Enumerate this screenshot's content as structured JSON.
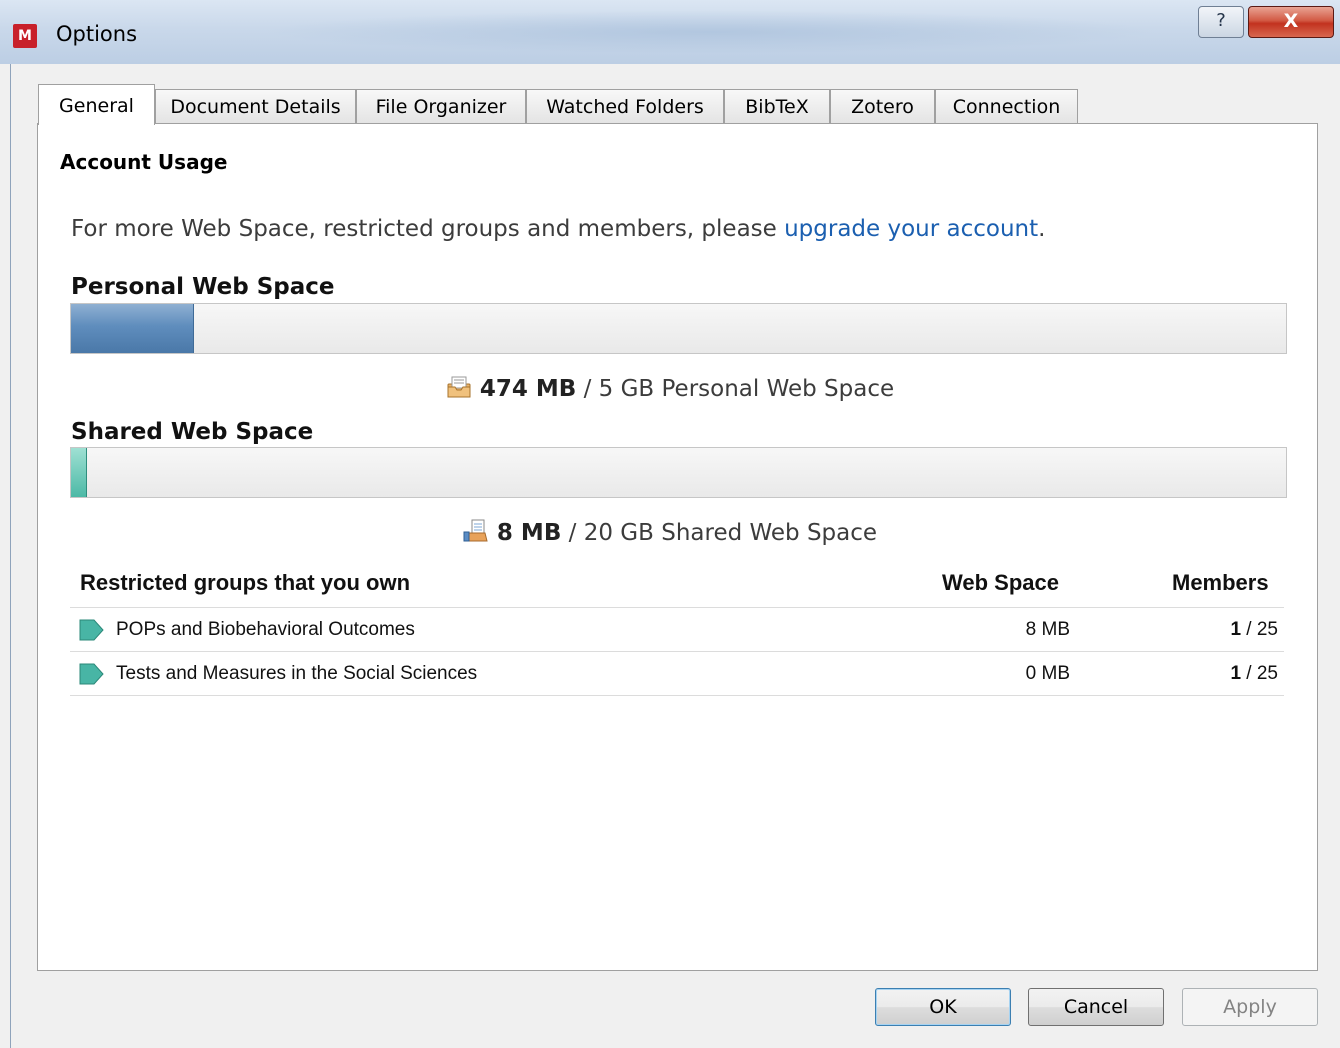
{
  "window": {
    "icon_glyph": "M",
    "title": "Options",
    "help_glyph": "?",
    "close_glyph": "X"
  },
  "tabs": [
    {
      "label": "General",
      "active": true
    },
    {
      "label": "Document Details"
    },
    {
      "label": "File Organizer"
    },
    {
      "label": "Watched Folders"
    },
    {
      "label": "BibTeX"
    },
    {
      "label": "Zotero"
    },
    {
      "label": "Connection"
    }
  ],
  "account_usage": {
    "title": "Account Usage",
    "upgrade_prefix": "For more Web Space, restricted groups and members, please ",
    "upgrade_link": "upgrade your account",
    "upgrade_suffix": "."
  },
  "personal": {
    "heading": "Personal Web Space",
    "used": "474 MB",
    "rest": " / 5 GB Personal Web Space",
    "fill_fraction": 0.1,
    "icon": "personal-storage-icon"
  },
  "shared": {
    "heading": "Shared Web Space",
    "used": "8 MB",
    "rest": " / 20 GB Shared Web Space",
    "fill_fraction": 0.012,
    "icon": "shared-storage-icon"
  },
  "groups": {
    "headers": {
      "name": "Restricted groups that you own",
      "space": "Web Space",
      "members": "Members"
    },
    "rows": [
      {
        "name": "POPs and Biobehavioral Outcomes",
        "space": "8 MB",
        "members_count": "1",
        "members_limit": " / 25"
      },
      {
        "name": "Tests and Measures in the Social Sciences",
        "space": "0 MB",
        "members_count": "1",
        "members_limit": " / 25"
      }
    ]
  },
  "buttons": {
    "ok": "OK",
    "cancel": "Cancel",
    "apply": "Apply"
  },
  "colors": {
    "personal_bar": "#5f8dbd",
    "shared_bar": "#4cb9a6",
    "link": "#1b5fb0",
    "close_button": "#c2321f"
  }
}
